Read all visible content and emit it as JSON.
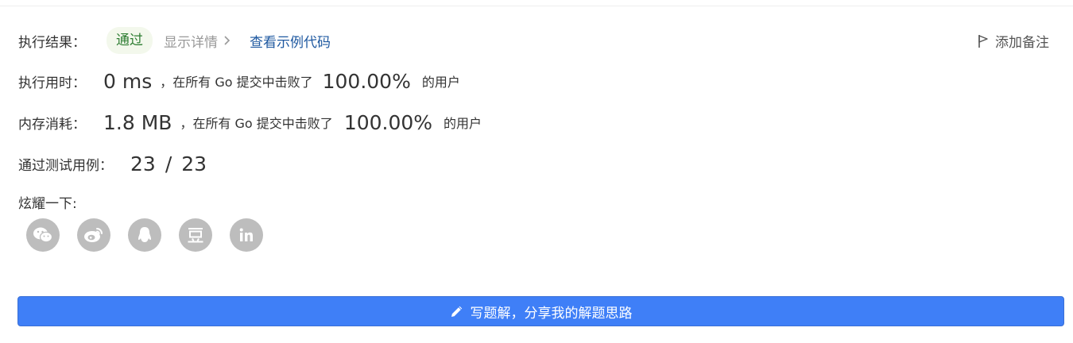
{
  "result": {
    "label": "执行结果：",
    "status": "通过",
    "detail_link": "显示详情",
    "example_link": "查看示例代码",
    "note_button": "添加备注"
  },
  "runtime": {
    "label": "执行用时：",
    "value": "0 ms",
    "middle": "，在所有 Go 提交中击败了",
    "percent": "100.00%",
    "tail": "的用户"
  },
  "memory": {
    "label": "内存消耗：",
    "value": "1.8 MB",
    "middle": "，在所有 Go 提交中击败了",
    "percent": "100.00%",
    "tail": "的用户"
  },
  "tests": {
    "label": "通过测试用例：",
    "passed": "23",
    "total": "23"
  },
  "share": {
    "label": "炫耀一下:",
    "icons": [
      "wechat-icon",
      "weibo-icon",
      "qq-icon",
      "douban-icon",
      "linkedin-icon"
    ]
  },
  "solution_button": "写题解，分享我的解题思路",
  "colors": {
    "accent": "#3f7ff7",
    "status_bg": "#f3f8ec",
    "status_text": "#2e7d32",
    "link": "#1e58a0",
    "icon_gray": "#bdbdbd"
  }
}
